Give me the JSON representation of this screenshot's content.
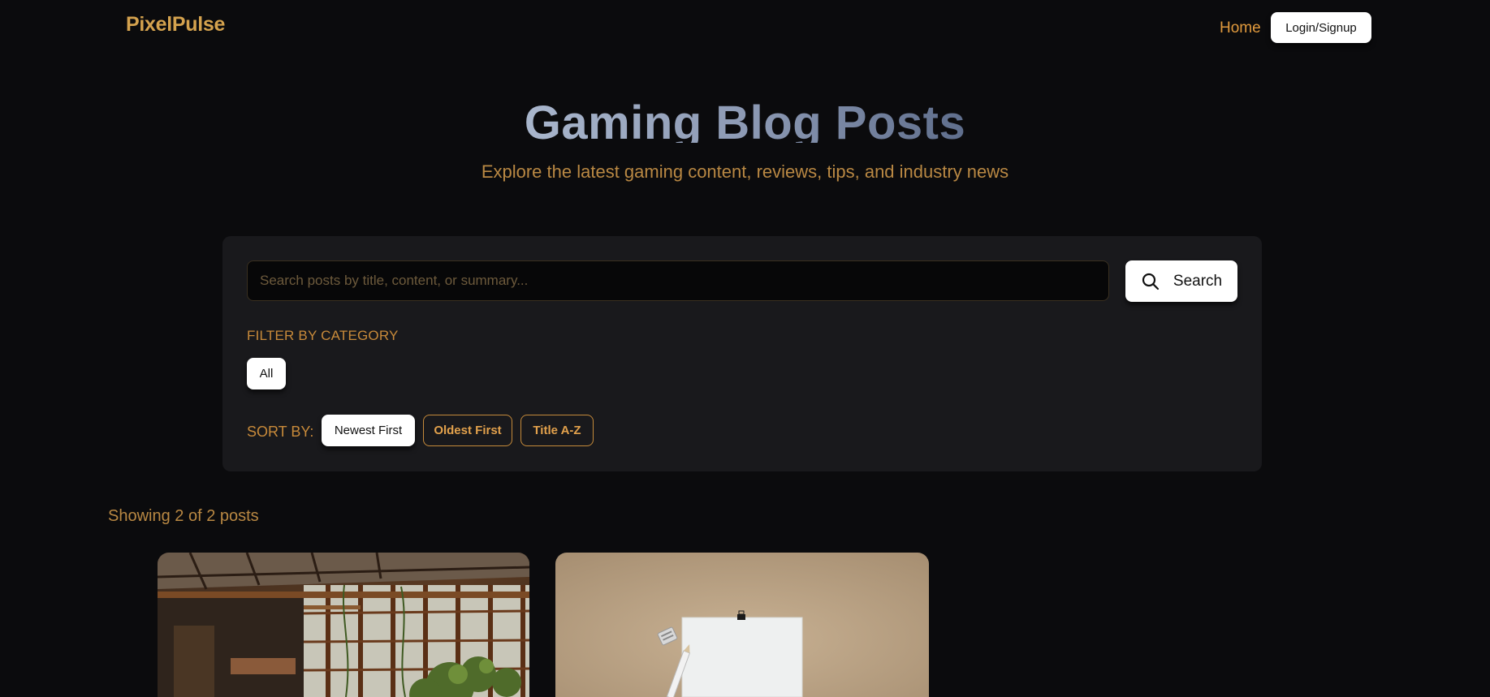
{
  "nav": {
    "brand": "PixelPulse",
    "home": "Home",
    "login": "Login/Signup"
  },
  "hero": {
    "title": "Gaming Blog Posts",
    "subtitle": "Explore the latest gaming content, reviews, tips, and industry news"
  },
  "search": {
    "placeholder": "Search posts by title, content, or summary...",
    "value": "",
    "button_label": "Search",
    "icon": "search-icon"
  },
  "filter": {
    "label": "FILTER BY CATEGORY",
    "categories": [
      "All"
    ],
    "selected": "All"
  },
  "sort": {
    "label": "SORT BY:",
    "options": [
      "Newest First",
      "Oldest First",
      "Title A-Z"
    ],
    "selected": "Newest First"
  },
  "results": {
    "text": "Showing 2 of 2 posts"
  },
  "colors": {
    "background": "#0b0b0d",
    "panel": "#19191c",
    "accent": "#e19a3d",
    "brand": "#d4a24e"
  }
}
